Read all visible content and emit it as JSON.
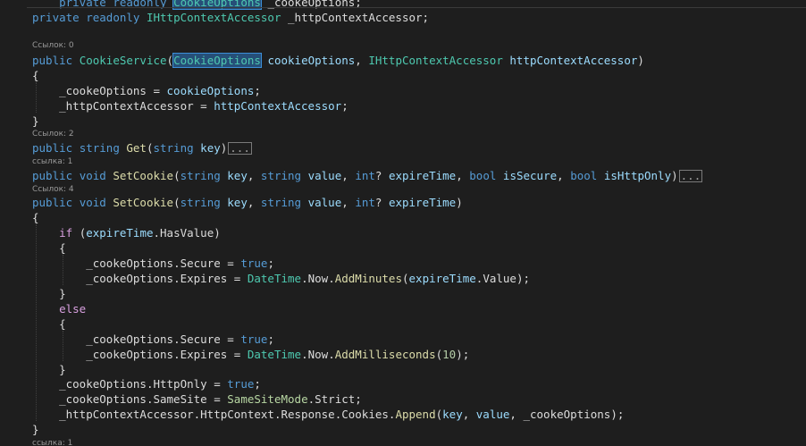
{
  "code_lens": {
    "ctor": "Ссылок: 0",
    "get": "Ссылок: 2",
    "setcookie_full": "ссылка: 1",
    "setcookie_short": "Ссылок: 4",
    "next": "ссылка: 1"
  },
  "tokens": {
    "private": "private",
    "readonly": "readonly",
    "public": "public",
    "string": "string",
    "void": "void",
    "int": "int",
    "bool": "bool",
    "true": "true",
    "if": "if",
    "else": "else",
    "CookieOptions": "CookieOptions",
    "IHttpContextAccessor": "IHttpContextAccessor",
    "CookieService": "CookieService",
    "Get": "Get",
    "SetCookie": "SetCookie",
    "AddMinutes": "AddMinutes",
    "AddMilliseconds": "AddMilliseconds",
    "Append": "Append",
    "DateTime": "DateTime",
    "SameSiteMode": "SameSiteMode",
    "Strict": "Strict",
    "_cookeOptions": "_cookeOptions",
    "_httpContextAccessor": "_httpContextAccessor",
    "cookieOptions": "cookieOptions",
    "httpContextAccessor": "httpContextAccessor",
    "key": "key",
    "value": "value",
    "expireTime": "expireTime",
    "isSecure": "isSecure",
    "isHttpOnly": "isHttpOnly",
    "HasValue": "HasValue",
    "Value": "Value",
    "Secure": "Secure",
    "Expires": "Expires",
    "HttpOnly": "HttpOnly",
    "SameSite": "SameSite",
    "Now": "Now",
    "HttpContext": "HttpContext",
    "Response": "Response",
    "Cookies": "Cookies",
    "ten": "10",
    "collapsed": "...",
    "open_brace": "{",
    "close_brace": "}"
  }
}
